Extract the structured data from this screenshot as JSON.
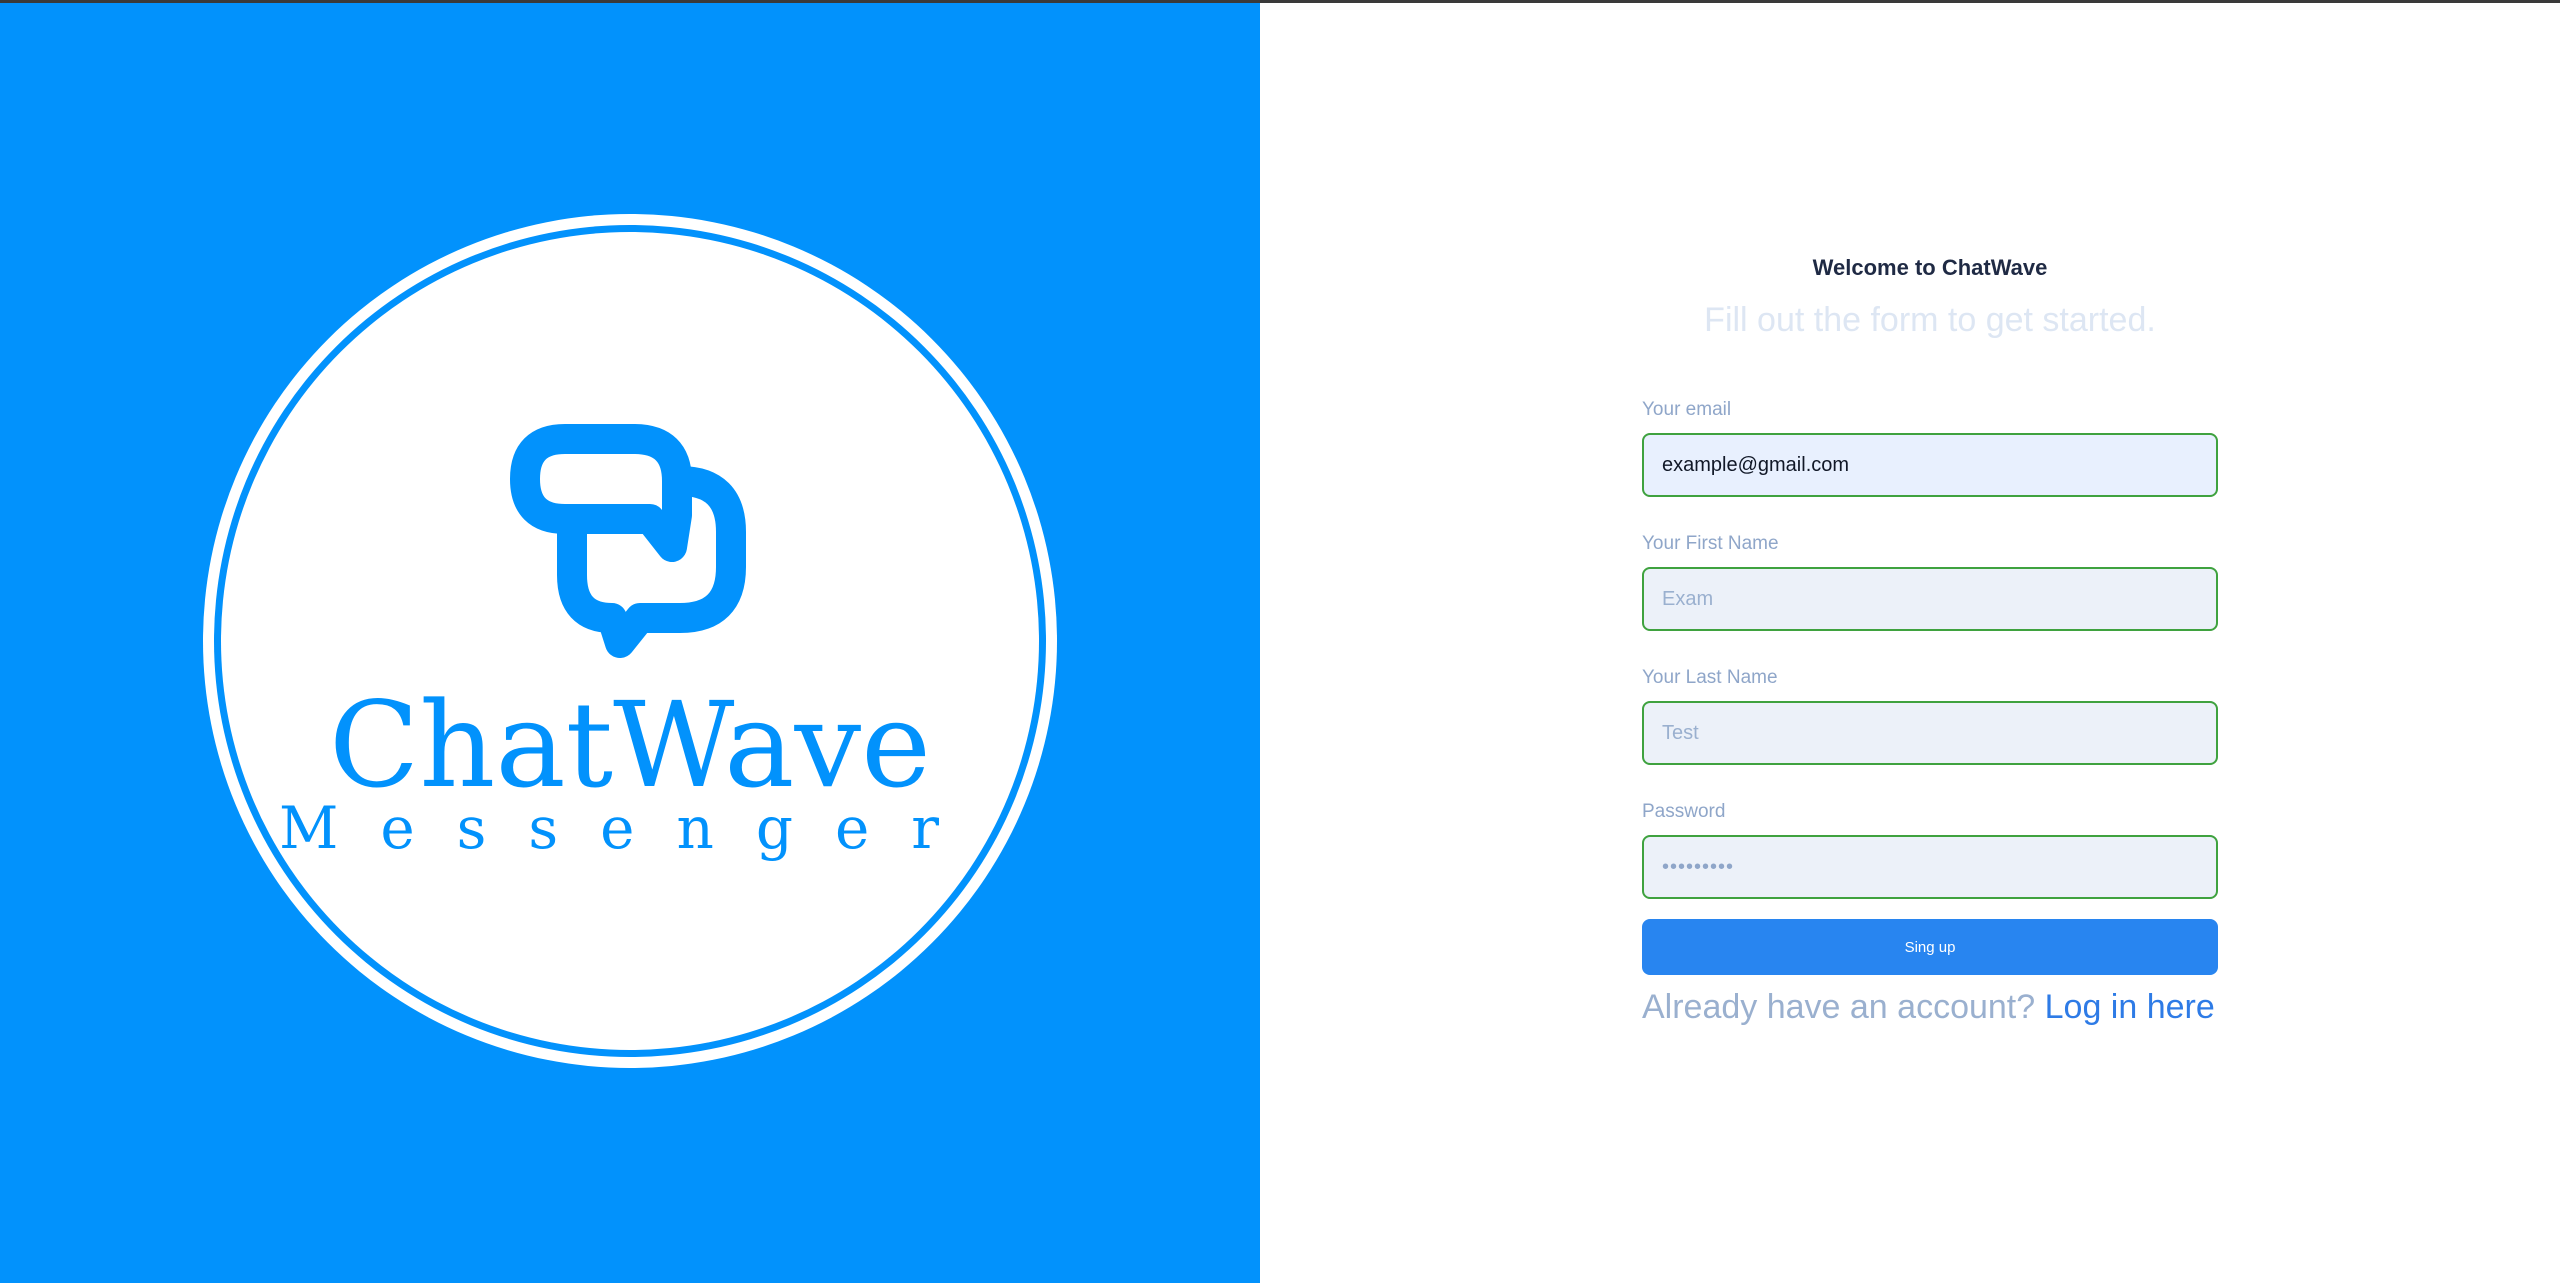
{
  "brand": {
    "name": "ChatWave",
    "tagline": "Messenger",
    "logo_icon": "chat-bubbles-icon",
    "colors": {
      "left_bg": "#0292fc",
      "accent": "#2885f0",
      "link": "#2e7be6",
      "field_border": "#3fa23f"
    }
  },
  "form": {
    "welcome": "Welcome to ChatWave",
    "subtitle": "Fill out the form to get started.",
    "email": {
      "label": "Your email",
      "value": "example@gmail.com",
      "placeholder": ""
    },
    "first_name": {
      "label": "Your First Name",
      "value": "",
      "placeholder": "Exam"
    },
    "last_name": {
      "label": "Your Last Name",
      "value": "",
      "placeholder": "Test"
    },
    "password": {
      "label": "Password",
      "value": "•••••••••"
    },
    "submit_label": "Sing up",
    "login_prompt": "Already have an account?",
    "login_link": "Log in here"
  }
}
